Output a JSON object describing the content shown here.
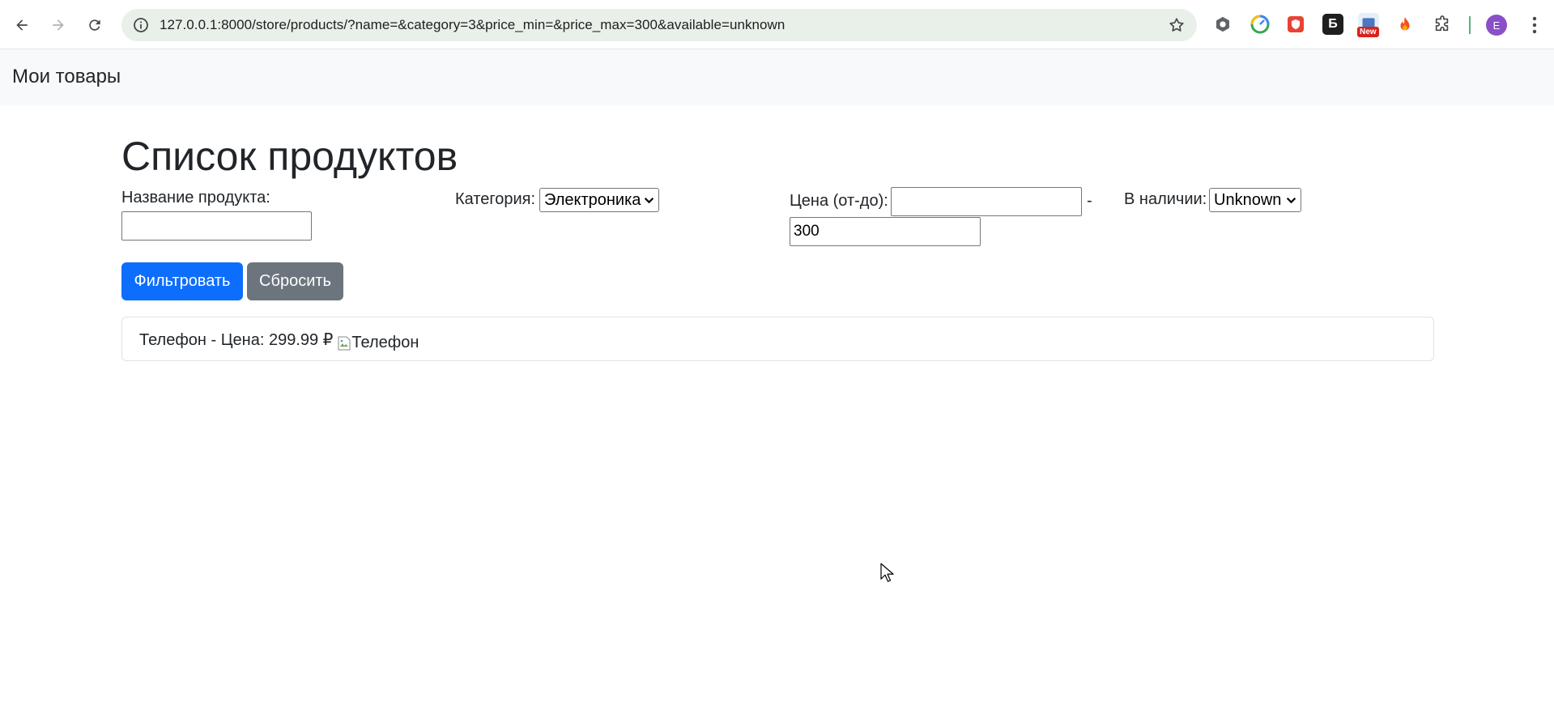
{
  "browser": {
    "url": "127.0.0.1:8000/store/products/?name=&category=3&price_min=&price_max=300&available=unknown",
    "profile_initial": "E",
    "extension_badge": "New",
    "extension_letter": "Б"
  },
  "navbar": {
    "brand": "Мои товары"
  },
  "page": {
    "title": "Список продуктов"
  },
  "filters": {
    "name_label": "Название продукта:",
    "name_value": "",
    "category_label": "Категория:",
    "category_selected": "Электроника",
    "price_label": "Цена (от-до):",
    "price_min_value": "",
    "price_separator": "-",
    "price_max_value": "300",
    "available_label": "В наличии:",
    "available_selected": "Unknown",
    "filter_button": "Фильтровать",
    "reset_button": "Сбросить"
  },
  "products": [
    {
      "text": "Телефон - Цена: 299.99 ₽",
      "image_alt": "Телефон"
    }
  ],
  "colors": {
    "primary": "#0d6efd",
    "secondary": "#6c757d",
    "navbar_bg": "#f8f9fa",
    "omnibox_bg": "#e8f0e9"
  }
}
